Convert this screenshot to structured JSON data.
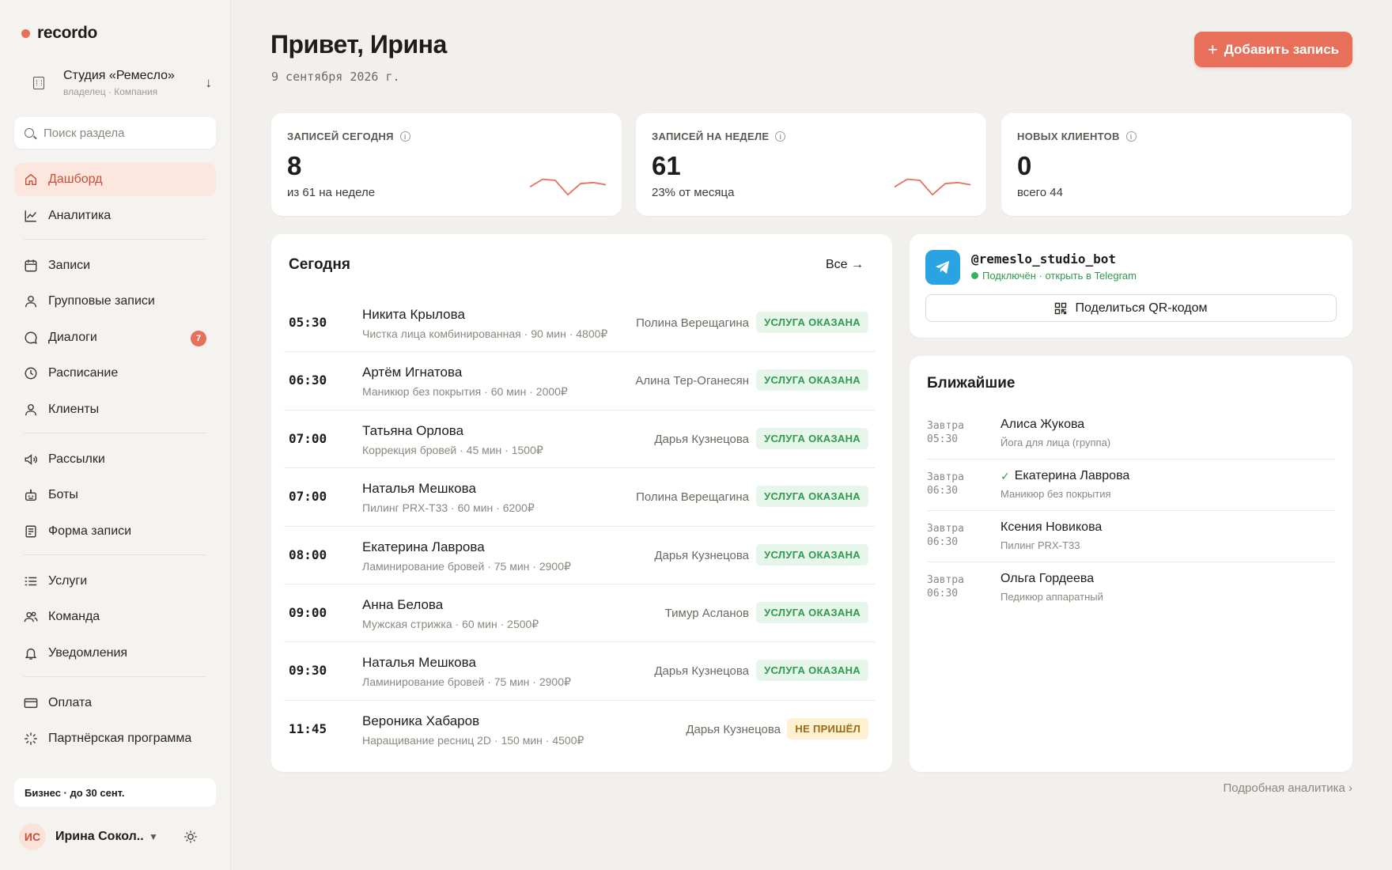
{
  "app": {
    "logo": "recordo"
  },
  "company": {
    "name": "Студия «Ремесло»",
    "role": "владелец · Компания"
  },
  "search": {
    "placeholder": "Поиск раздела"
  },
  "nav": [
    {
      "label": "Дашборд",
      "icon": "home-icon",
      "active": true
    },
    {
      "label": "Аналитика",
      "icon": "chart-icon"
    },
    {
      "label": "Записи",
      "icon": "calendar-icon"
    },
    {
      "label": "Групповые записи",
      "icon": "user-icon"
    },
    {
      "label": "Диалоги",
      "icon": "chat-icon",
      "badge": "7"
    },
    {
      "label": "Расписание",
      "icon": "clock-icon"
    },
    {
      "label": "Клиенты",
      "icon": "user-icon"
    },
    {
      "label": "Рассылки",
      "icon": "megaphone-icon"
    },
    {
      "label": "Боты",
      "icon": "bot-icon"
    },
    {
      "label": "Форма записи",
      "icon": "form-icon"
    },
    {
      "label": "Услуги",
      "icon": "list-icon"
    },
    {
      "label": "Команда",
      "icon": "team-icon"
    },
    {
      "label": "Уведомления",
      "icon": "bell-icon"
    },
    {
      "label": "Оплата",
      "icon": "card-icon"
    },
    {
      "label": "Партнёрская программа",
      "icon": "sparkle-icon"
    }
  ],
  "plan": {
    "text": "Бизнес · до 30 сент."
  },
  "user": {
    "initials": "ИС",
    "name": "Ирина Сокол..."
  },
  "header": {
    "greeting": "Привет, Ирина",
    "date": "9 сентября 2026 г.",
    "add_label": "Добавить запись"
  },
  "stats": [
    {
      "label": "ЗАПИСЕЙ СЕГОДНЯ",
      "value": "8",
      "sub": "из 61 на неделе",
      "spark": [
        0.55,
        0.2,
        0.25,
        0.9,
        0.4,
        0.35,
        0.45
      ]
    },
    {
      "label": "ЗАПИСЕЙ НА НЕДЕЛЕ",
      "value": "61",
      "sub": "23% от месяца",
      "spark": [
        0.55,
        0.2,
        0.25,
        0.9,
        0.4,
        0.35,
        0.45
      ]
    },
    {
      "label": "НОВЫХ КЛИЕНТОВ",
      "value": "0",
      "sub": "всего 44"
    }
  ],
  "today": {
    "title": "Сегодня",
    "all_label": "Все →",
    "rows": [
      {
        "time": "05:30",
        "name": "Никита Крылова",
        "service": "Чистка лица комбинированная · 90 мин · 4800₽",
        "master": "Полина Верещагина",
        "status": "УСЛУГА ОКАЗАНА",
        "kind": "done"
      },
      {
        "time": "06:30",
        "name": "Артём Игнатова",
        "service": "Маникюр без покрытия · 60 мин · 2000₽",
        "master": "Алина Тер-Оганесян",
        "status": "УСЛУГА ОКАЗАНА",
        "kind": "done"
      },
      {
        "time": "07:00",
        "name": "Татьяна Орлова",
        "service": "Коррекция бровей · 45 мин · 1500₽",
        "master": "Дарья Кузнецова",
        "status": "УСЛУГА ОКАЗАНА",
        "kind": "done"
      },
      {
        "time": "07:00",
        "name": "Наталья Мешкова",
        "service": "Пилинг PRX-T33 · 60 мин · 6200₽",
        "master": "Полина Верещагина",
        "status": "УСЛУГА ОКАЗАНА",
        "kind": "done"
      },
      {
        "time": "08:00",
        "name": "Екатерина Лаврова",
        "service": "Ламинирование бровей · 75 мин · 2900₽",
        "master": "Дарья Кузнецова",
        "status": "УСЛУГА ОКАЗАНА",
        "kind": "done"
      },
      {
        "time": "09:00",
        "name": "Анна Белова",
        "service": "Мужская стрижка · 60 мин · 2500₽",
        "master": "Тимур Асланов",
        "status": "УСЛУГА ОКАЗАНА",
        "kind": "done"
      },
      {
        "time": "09:30",
        "name": "Наталья Мешкова",
        "service": "Ламинирование бровей · 75 мин · 2900₽",
        "master": "Дарья Кузнецова",
        "status": "УСЛУГА ОКАЗАНА",
        "kind": "done"
      },
      {
        "time": "11:45",
        "name": "Вероника Хабаров",
        "service": "Наращивание ресниц 2D · 150 мин · 4500₽",
        "master": "Дарья Кузнецова",
        "status": "НЕ ПРИШЁЛ",
        "kind": "noshow"
      }
    ]
  },
  "bot": {
    "handle": "@remeslo_studio_bot",
    "status": "Подключён · открыть в Telegram",
    "share_label": "Поделиться QR-кодом"
  },
  "upcoming": {
    "title": "Ближайшие",
    "items": [
      {
        "day": "Завтра",
        "time": "05:30",
        "name": "Алиса Жукова",
        "service": "Йога для лица (группа)",
        "confirmed": false
      },
      {
        "day": "Завтра",
        "time": "06:30",
        "name": "Екатерина Лаврова",
        "service": "Маникюр без покрытия",
        "confirmed": true
      },
      {
        "day": "Завтра",
        "time": "06:30",
        "name": "Ксения Новикова",
        "service": "Пилинг PRX-T33",
        "confirmed": false
      },
      {
        "day": "Завтра",
        "time": "06:30",
        "name": "Ольга Гордеева",
        "service": "Педикюр аппаратный",
        "confirmed": false
      }
    ]
  },
  "footer": {
    "analytics_link": "Подробная аналитика ›"
  },
  "colors": {
    "accent": "#e8705a",
    "success": "#2f9a4d",
    "warning": "#9a6b10",
    "telegram": "#2aa3e3"
  }
}
